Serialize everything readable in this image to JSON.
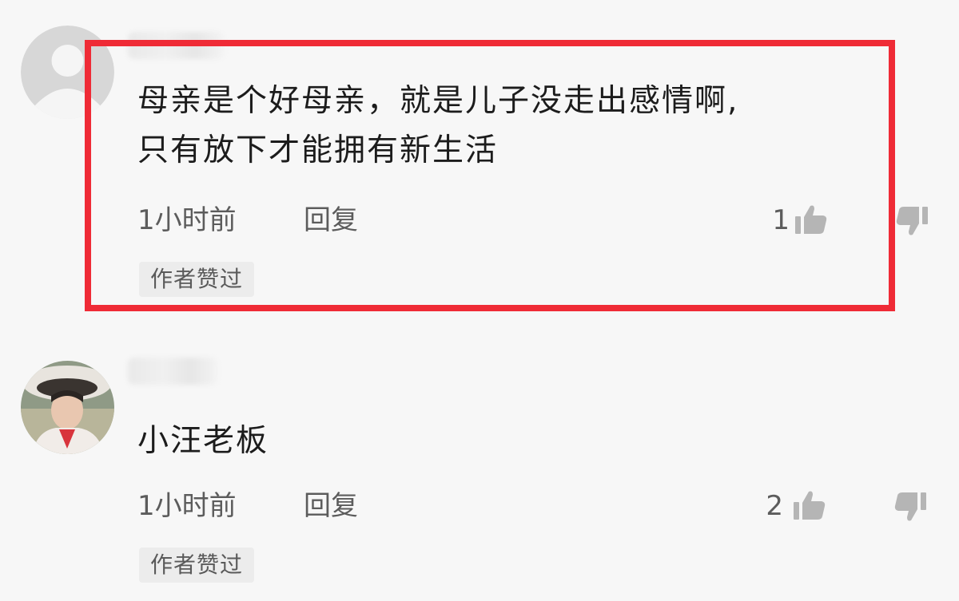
{
  "comments": [
    {
      "text_line1": "母亲是个好母亲，就是儿子没走出感情啊,",
      "text_line2": "只有放下才能拥有新生活",
      "time": "1小时前",
      "reply_label": "回复",
      "likes": "1",
      "badge": "作者赞过",
      "avatar": "default-user-icon"
    },
    {
      "text_line1": "小汪老板",
      "time": "1小时前",
      "reply_label": "回复",
      "likes": "2",
      "badge": "作者赞过",
      "avatar": "user-photo"
    }
  ],
  "colors": {
    "highlight": "#ef2b36",
    "text": "#1c1c1c",
    "meta": "#5c5c5c",
    "badge_bg": "#ececec"
  }
}
